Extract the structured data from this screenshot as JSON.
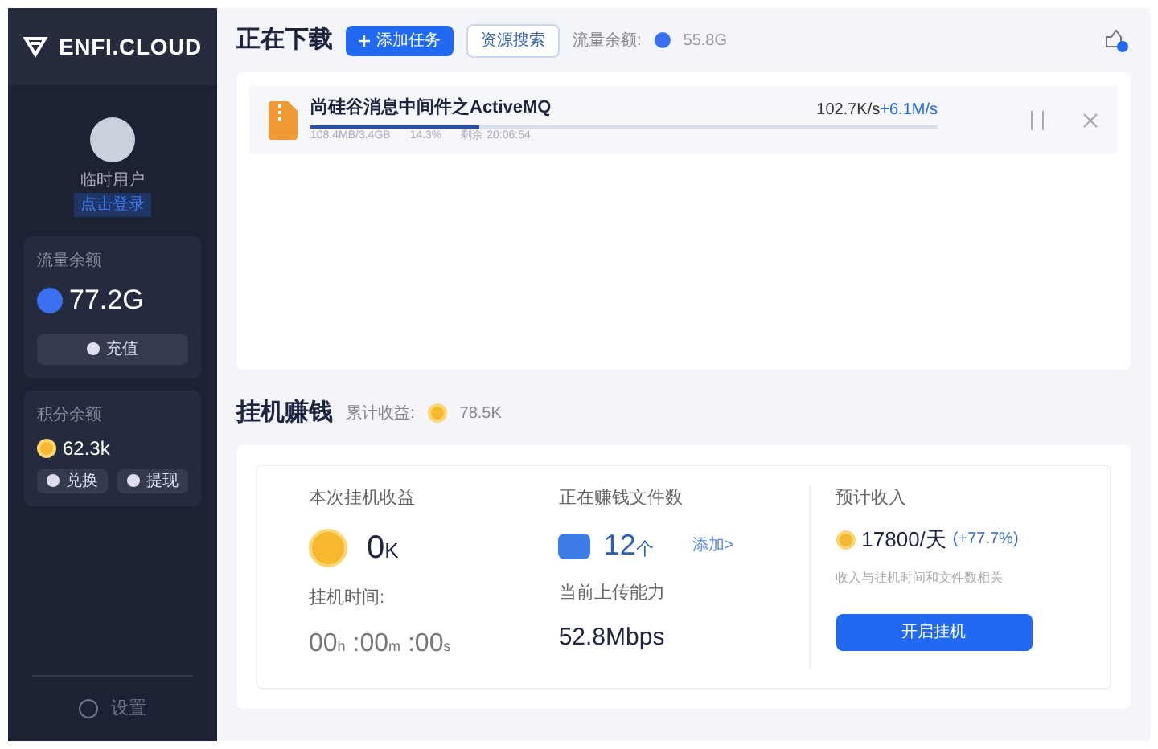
{
  "sidebar": {
    "logo": "ENFI.CLOUD",
    "user": {
      "name": "临时用户",
      "login_link": "点击登录"
    },
    "traffic_card": {
      "label": "流量余额",
      "value": "77.2G",
      "button": "充值"
    },
    "points_card": {
      "label": "积分余额",
      "value": "62.3k",
      "buttons": [
        "兑换",
        "提现"
      ]
    },
    "settings": "设置"
  },
  "downloads": {
    "title": "正在下载",
    "add_button": "添加任务",
    "search_button": "资源搜索",
    "quota_label": "流量余额:",
    "quota_value": "55.8G",
    "items": [
      {
        "name": "尚硅谷消息中间件之ActiveMQ",
        "speed": "102.7K/s",
        "boost": "+6.1M/s",
        "level": 0.27,
        "size": "108.4MB/3.4GB",
        "percent": "14.3%",
        "remaining": "剩余 20:06:54"
      }
    ]
  },
  "earning": {
    "title": "挂机赚钱",
    "total_label": "累计收益:",
    "total_value": "78.5K",
    "session": {
      "label": "本次挂机收益",
      "value": "0",
      "unit": "K",
      "time_label": "挂机时间:",
      "hours": "00",
      "h": "h",
      "minutes": ":00",
      "m": "m",
      "seconds": ":00",
      "s": "s"
    },
    "files": {
      "label": "正在赚钱文件数",
      "count": "12",
      "unit": "个",
      "add_link": "添加>",
      "upload_label": "当前上传能力",
      "upload_value": "52.8Mbps"
    },
    "forecast": {
      "label": "预计收入",
      "value": "17800/天",
      "change": "(+77.7%)",
      "note": "收入与挂机时间和文件数相关",
      "button": "开启挂机"
    }
  }
}
